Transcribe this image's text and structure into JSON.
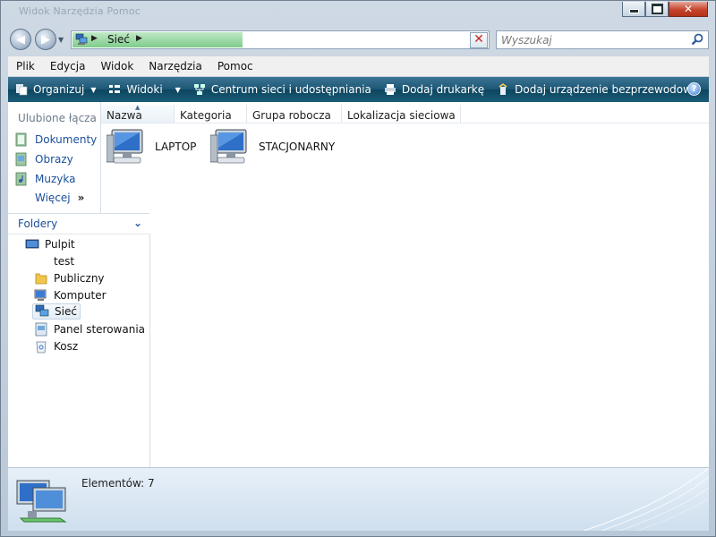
{
  "window": {
    "title": "Widok  Narzędzia  Pomoc"
  },
  "address": {
    "location": "Sieć",
    "search_placeholder": "Wyszukaj"
  },
  "menu": [
    "Plik",
    "Edycja",
    "Widok",
    "Narzędzia",
    "Pomoc"
  ],
  "toolbar": {
    "organize": "Organizuj",
    "views": "Widoki",
    "network_center": "Centrum sieci i udostępniania",
    "add_printer": "Dodaj drukarkę",
    "add_wireless": "Dodaj urządzenie bezprzewodowe",
    "help_glyph": "?"
  },
  "favorites": {
    "title": "Ulubione łącza",
    "items": [
      "Dokumenty",
      "Obrazy",
      "Muzyka"
    ],
    "more": "Więcej",
    "more_glyph": "»"
  },
  "folders": {
    "title": "Foldery",
    "chevron": "⌄",
    "tree": [
      "Pulpit",
      "test",
      "Publiczny",
      "Komputer",
      "Sieć",
      "Panel sterowania",
      "Kosz"
    ]
  },
  "columns": [
    "Nazwa",
    "Kategoria",
    "Grupa robocza",
    "Lokalizacja sieciowa"
  ],
  "items": [
    "LAPTOP",
    "STACJONARNY"
  ],
  "status": {
    "text": "Elementów: 7"
  },
  "colors": {
    "toolbar": "#1b5673",
    "link": "#1b4f9c",
    "progress": "#7fcc8c"
  }
}
